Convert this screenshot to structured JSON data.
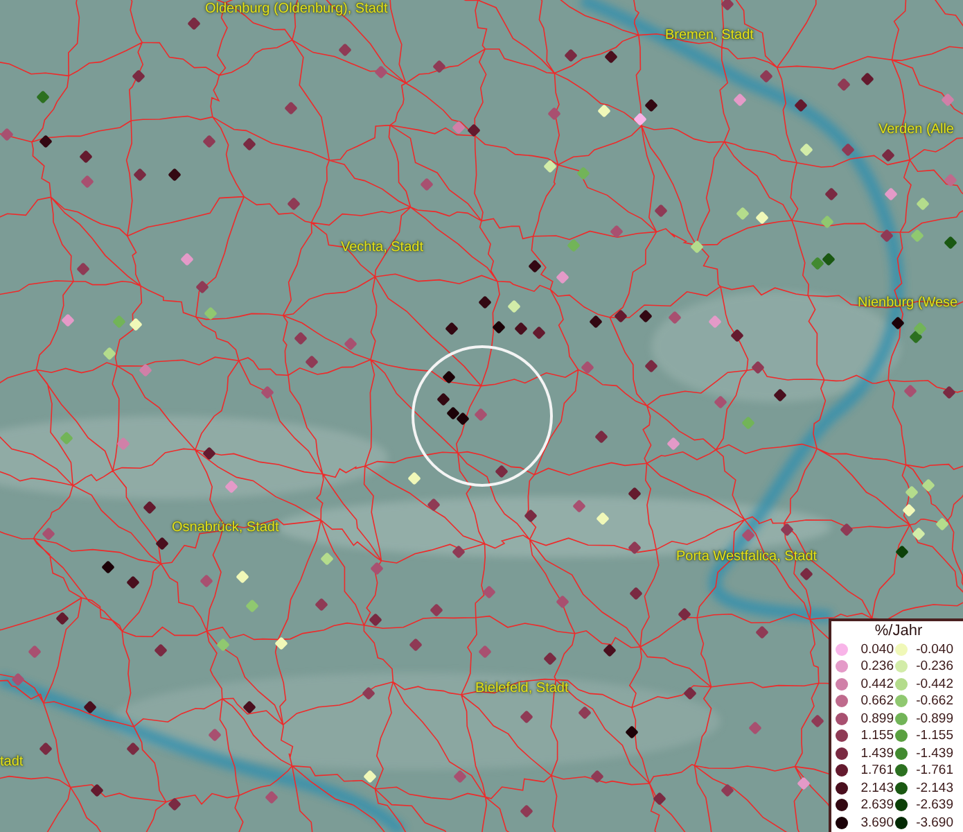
{
  "map_labels": [
    "Oldenburg (Oldenburg), Stadt",
    "Bremen, Stadt",
    "Verden (Alle",
    "Vechta, Stadt",
    "Nienburg (Wese",
    "Osnabrück, Stadt",
    "Porta Westfalica, Stadt",
    "Bielefeld, Stadt",
    "tadt"
  ],
  "legend": {
    "title": "%/Jahr",
    "positive": [
      {
        "label": "0.040",
        "color": "#f8b4e8"
      },
      {
        "label": "0.236",
        "color": "#e49ac8"
      },
      {
        "label": "0.442",
        "color": "#d080a8"
      },
      {
        "label": "0.662",
        "color": "#bf6a8c"
      },
      {
        "label": "0.899",
        "color": "#a85070"
      },
      {
        "label": "1.155",
        "color": "#8f3a55"
      },
      {
        "label": "1.439",
        "color": "#7a2a42"
      },
      {
        "label": "1.761",
        "color": "#641a2e"
      },
      {
        "label": "2.143",
        "color": "#4a0f1e"
      },
      {
        "label": "2.639",
        "color": "#330812"
      },
      {
        "label": "3.690",
        "color": "#1c0208"
      }
    ],
    "negative": [
      {
        "label": "-0.040",
        "color": "#f0f8b8"
      },
      {
        "label": "-0.236",
        "color": "#d2eca8"
      },
      {
        "label": "-0.442",
        "color": "#b4dc8c"
      },
      {
        "label": "-0.662",
        "color": "#90c870"
      },
      {
        "label": "-0.899",
        "color": "#72b458"
      },
      {
        "label": "-1.155",
        "color": "#5aa040"
      },
      {
        "label": "-1.439",
        "color": "#428a30"
      },
      {
        "label": "-1.761",
        "color": "#2c7020"
      },
      {
        "label": "-2.143",
        "color": "#1a5812"
      },
      {
        "label": "-2.639",
        "color": "#0c4008"
      },
      {
        "label": "-3.690",
        "color": "#042a04"
      }
    ]
  }
}
